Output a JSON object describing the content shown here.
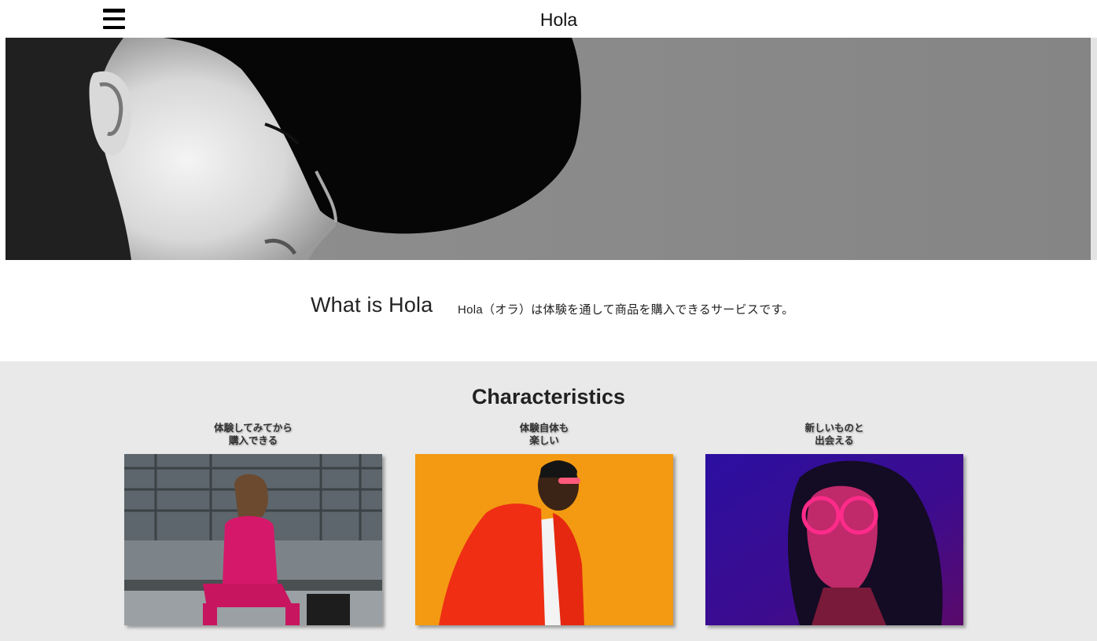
{
  "header": {
    "brand": "Hola",
    "menu_icon": "hamburger-menu-icon"
  },
  "hero": {
    "image_desc_icon": "portrait-photo"
  },
  "about": {
    "title": "What is Hola",
    "text": "Hola（オラ）は体験を通して商品を購入できるサービスです。"
  },
  "characteristics": {
    "title": "Characteristics",
    "cards": [
      {
        "line1": "体験してみてから",
        "line2": "購入できる"
      },
      {
        "line1": "体験自体も",
        "line2": "楽しい"
      },
      {
        "line1": "新しいものと",
        "line2": "出会える"
      }
    ]
  },
  "colors": {
    "chars_bg": "#e9e9e9",
    "hero_bg": "#8a8a8a",
    "card2_bg": "#f39a12",
    "card3_bg": "#3a0f8a"
  }
}
